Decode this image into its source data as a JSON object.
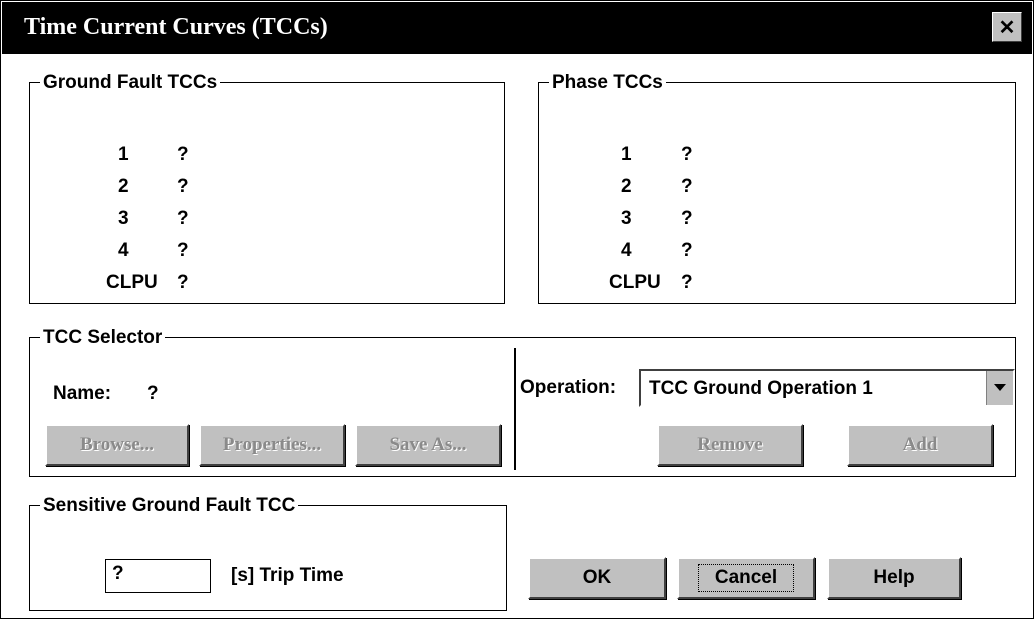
{
  "window": {
    "title": "Time Current Curves (TCCs)",
    "close_label": "✕"
  },
  "ground_fault": {
    "label": "Ground Fault TCCs",
    "rows": [
      {
        "key": "1",
        "value": "?"
      },
      {
        "key": "2",
        "value": "?"
      },
      {
        "key": "3",
        "value": "?"
      },
      {
        "key": "4",
        "value": "?"
      },
      {
        "key": "CLPU",
        "value": "?"
      }
    ]
  },
  "phase": {
    "label": "Phase TCCs",
    "rows": [
      {
        "key": "1",
        "value": "?"
      },
      {
        "key": "2",
        "value": "?"
      },
      {
        "key": "3",
        "value": "?"
      },
      {
        "key": "4",
        "value": "?"
      },
      {
        "key": "CLPU",
        "value": "?"
      }
    ]
  },
  "selector": {
    "label": "TCC Selector",
    "name_label": "Name:",
    "name_value": "?",
    "browse": "Browse...",
    "properties": "Properties...",
    "save_as": "Save As...",
    "operation_label": "Operation:",
    "operation_value": "TCC Ground Operation 1",
    "remove": "Remove",
    "add": "Add"
  },
  "sensitive": {
    "label": "Sensitive Ground Fault TCC",
    "value": "?",
    "unit_label": "[s] Trip Time"
  },
  "buttons": {
    "ok": "OK",
    "cancel": "Cancel",
    "help": "Help"
  }
}
